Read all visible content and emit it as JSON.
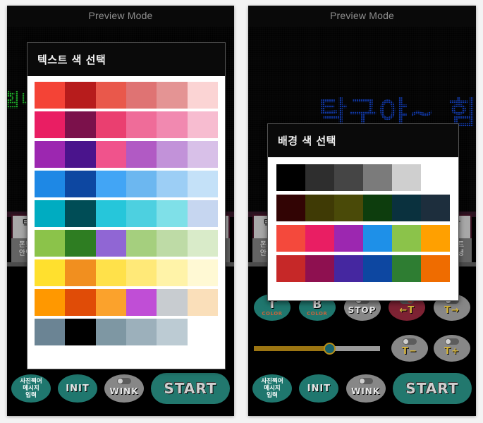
{
  "app": {
    "preview_mode_label": "Preview Mode"
  },
  "left_panel": {
    "preview_title": "Preview Mode",
    "led_text": "힘내",
    "led_text_color": "#1ea92a",
    "side_tabs": [
      {
        "label": "탁"
      },
      {
        "label": "폰트\n안녕"
      }
    ],
    "dialog": {
      "title": "텍스트 색 선택",
      "rows": [
        [
          "#f44336",
          "#b71c1c",
          "#e9584b",
          "#df7373",
          "#e49494",
          "#fbd4d4"
        ],
        [
          "#e91e63",
          "#7b114b",
          "#ea3f70",
          "#ef6c99",
          "#f189b0",
          "#f7bcd0"
        ],
        [
          "#9c27b0",
          "#4a148c",
          "#f0538c",
          "#b15ac4",
          "#c292d9",
          "#d8c0e8"
        ],
        [
          "#1e88e5",
          "#0d47a1",
          "#42a5f5",
          "#6cb7f0",
          "#9ccef5",
          "#c4e1f8"
        ],
        [
          "#00acc1",
          "#004d56",
          "#26c6da",
          "#4dd0e0",
          "#7fe0e8",
          "#c6d6f0"
        ],
        [
          "#8bc34a",
          "#2e7d22",
          "#9066d4",
          "#a5cf7e",
          "#bedba6",
          "#d9ebc9"
        ],
        [
          "#ffe02e",
          "#f18f1f",
          "#ffe14a",
          "#ffe978",
          "#fff3a8",
          "#fff9d4"
        ],
        [
          "#ff9800",
          "#e04c07",
          "#fba22c",
          "#c04ed6",
          "#c8ccd0",
          "#fadfba"
        ],
        [
          "#6b8494",
          "#000000",
          "#7e97a3",
          "#9cb0bb",
          "#bccbd3"
        ]
      ]
    },
    "buttons": [
      {
        "name": "photo-message-input",
        "line1": "사진찍어",
        "line2": "메시지",
        "line3": "입력",
        "color": "#1f776e"
      },
      {
        "name": "init",
        "label": "INIT",
        "color": "#1f776e"
      },
      {
        "name": "wink",
        "label": "WINK",
        "color": "#878787",
        "toggle": true
      },
      {
        "name": "start",
        "label": "START",
        "color": "#22786e"
      }
    ]
  },
  "right_panel": {
    "preview_title": "Preview Mode",
    "led_text": "탁구야~ 힘",
    "led_text_color": "#12379e",
    "side_tabs": [
      {
        "label": "탁"
      },
      {
        "label": "폰트\n안녕"
      }
    ],
    "dialog": {
      "title": "배경 색 선택",
      "rows": [
        [
          "#000000",
          "#2e2e2e",
          "#454545",
          "#7b7b7b",
          "#cfcfcf"
        ],
        [
          "#320404",
          "#3f3a05",
          "#4a4a08",
          "#0d3d0d",
          "#0a313e",
          "#1d2e3d"
        ],
        [
          "#f4493c",
          "#e91e63",
          "#9c27b0",
          "#1e90e8",
          "#8bc34a",
          "#ffa000"
        ],
        [
          "#c62828",
          "#8e1050",
          "#4527a0",
          "#0d47a1",
          "#2e7d32",
          "#ef6c00"
        ]
      ]
    },
    "buttons_row1": [
      {
        "name": "text-color",
        "big": "T",
        "sub": "COLOR",
        "color": "#1f776e"
      },
      {
        "name": "background-color",
        "big": "B",
        "sub": "COLOR",
        "color": "#1f776e"
      },
      {
        "name": "stop",
        "label": "STOP",
        "color": "#878787",
        "toggle": true
      },
      {
        "name": "text-left",
        "label": "←T",
        "color": "#7d2233",
        "toggle": true
      },
      {
        "name": "text-right",
        "label": "T→",
        "color": "#878787",
        "toggle": true
      }
    ],
    "speed_slider": {
      "name": "speed-slider",
      "value": 60,
      "min": 0,
      "max": 100,
      "fill_color": "#9c7512",
      "track_color": "#9a9a9a",
      "thumb_color": "#18636c"
    },
    "buttons_row2": [
      {
        "name": "text-size-minus",
        "label": "T−",
        "color": "#878787",
        "toggle": true
      },
      {
        "name": "text-size-plus",
        "label": "T+",
        "color": "#878787",
        "toggle": true
      }
    ],
    "buttons_row3": [
      {
        "name": "photo-message-input",
        "line1": "사진찍어",
        "line2": "메시지",
        "line3": "입력",
        "color": "#1f776e"
      },
      {
        "name": "init",
        "label": "INIT",
        "color": "#1f776e"
      },
      {
        "name": "wink",
        "label": "WINK",
        "color": "#878787",
        "toggle": true
      },
      {
        "name": "start",
        "label": "START",
        "color": "#22786e"
      }
    ]
  }
}
